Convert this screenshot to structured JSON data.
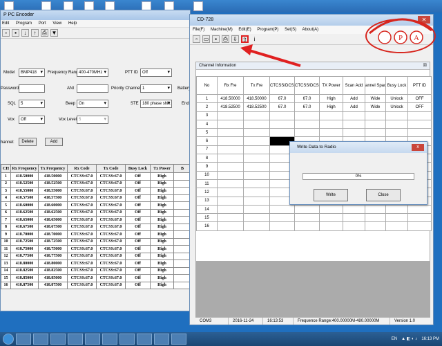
{
  "encoder_window": {
    "title": "P PC Encoder",
    "menu": [
      "Edit",
      "Program",
      "Port",
      "View",
      "Help"
    ],
    "setting_label": "etting",
    "fields": {
      "model_label": "Model",
      "model_value": "BMP418",
      "freq_range_label": "Frequency Range",
      "freq_range_value": "400-470MHz",
      "ptt_id_label": "PTT ID",
      "ptt_id_value": "Off",
      "password_label": "Password",
      "ani_label": "ANI",
      "priority_label": "Priority Channel",
      "priority_value": "1",
      "battery_label": "Battery",
      "sql_label": "SQL",
      "sql_value": "5",
      "beep_label": "Beep",
      "beep_value": "On",
      "ste_label": "STE",
      "ste_value": "180 phase shift",
      "end_label": "End",
      "vox_label": "Vox",
      "vox_value": "Off",
      "vox_level_label": "Vox Level",
      "vox_level_value": "5",
      "channel_label": "hannel:",
      "delete_label": "Delete",
      "add_label": "Add"
    },
    "table": {
      "headers": [
        "CH",
        "Rx Frequency",
        "Tx Frequency",
        "Rx Code",
        "Tx Code",
        "Busy Lock",
        "Tx Power",
        "B"
      ],
      "rows": [
        [
          "1",
          "418.50000",
          "418.50000",
          "CTCSS:67.0",
          "CTCSS:67.0",
          "Off",
          "High",
          ""
        ],
        [
          "2",
          "418.52500",
          "418.52500",
          "CTCSS:67.0",
          "CTCSS:67.0",
          "Off",
          "High",
          ""
        ],
        [
          "3",
          "418.55000",
          "418.55000",
          "CTCSS:67.0",
          "CTCSS:67.0",
          "Off",
          "High",
          ""
        ],
        [
          "4",
          "418.57500",
          "418.57500",
          "CTCSS:67.0",
          "CTCSS:67.0",
          "Off",
          "High",
          ""
        ],
        [
          "5",
          "418.60000",
          "418.60000",
          "CTCSS:67.0",
          "CTCSS:67.0",
          "Off",
          "High",
          ""
        ],
        [
          "6",
          "418.62500",
          "418.62500",
          "CTCSS:67.0",
          "CTCSS:67.0",
          "Off",
          "High",
          ""
        ],
        [
          "7",
          "418.65000",
          "418.65000",
          "CTCSS:67.0",
          "CTCSS:67.0",
          "Off",
          "High",
          ""
        ],
        [
          "8",
          "418.67500",
          "418.67500",
          "CTCSS:67.0",
          "CTCSS:67.0",
          "Off",
          "High",
          ""
        ],
        [
          "9",
          "418.70000",
          "418.70000",
          "CTCSS:67.0",
          "CTCSS:67.0",
          "Off",
          "High",
          ""
        ],
        [
          "10",
          "418.72500",
          "418.72500",
          "CTCSS:67.0",
          "CTCSS:67.0",
          "Off",
          "High",
          ""
        ],
        [
          "11",
          "418.75000",
          "418.75000",
          "CTCSS:67.0",
          "CTCSS:67.0",
          "Off",
          "High",
          ""
        ],
        [
          "12",
          "418.77500",
          "418.77500",
          "CTCSS:67.0",
          "CTCSS:67.0",
          "Off",
          "High",
          ""
        ],
        [
          "13",
          "418.80000",
          "418.80000",
          "CTCSS:67.0",
          "CTCSS:67.0",
          "Off",
          "High",
          ""
        ],
        [
          "14",
          "418.82500",
          "418.82500",
          "CTCSS:67.0",
          "CTCSS:67.0",
          "Off",
          "High",
          ""
        ],
        [
          "15",
          "418.85000",
          "418.85000",
          "CTCSS:67.0",
          "CTCSS:67.0",
          "Off",
          "High",
          ""
        ],
        [
          "16",
          "418.87500",
          "418.87500",
          "CTCSS:67.0",
          "CTCSS:67.0",
          "Off",
          "High",
          ""
        ]
      ]
    }
  },
  "cd_window": {
    "title": "CD-728",
    "menu": [
      "File(F)",
      "Machine(M)",
      "Edit(E)",
      "Program(P)",
      "Set(S)",
      "About(A)"
    ],
    "panel_title": "Channel Information",
    "panel_close": "☒",
    "table": {
      "headers": [
        "No",
        "Rx Fre",
        "Tx Fre",
        "CTCSS/DCS Dec",
        "CTCSS/DCS Enc",
        "TX Power",
        "Scan Add",
        "annel Spac",
        "Busy Lock",
        "PTT ID"
      ],
      "rows": [
        [
          "1",
          "418.50000",
          "418.50000",
          "67.0",
          "67.0",
          "High",
          "Add",
          "Wide",
          "Unlock",
          "OFF"
        ],
        [
          "2",
          "418.52500",
          "418.52500",
          "67.0",
          "67.0",
          "High",
          "Add",
          "Wide",
          "Unlock",
          "OFF"
        ],
        [
          "3",
          "",
          "",
          "",
          "",
          "",
          "",
          "",
          "",
          ""
        ],
        [
          "4",
          "",
          "",
          "",
          "",
          "",
          "",
          "",
          "",
          ""
        ],
        [
          "5",
          "",
          "",
          "",
          "",
          "",
          "",
          "",
          "",
          ""
        ],
        [
          "6",
          "",
          "",
          "",
          "",
          "",
          "",
          "",
          "",
          ""
        ],
        [
          "7",
          "",
          "",
          "",
          "",
          "",
          "",
          "",
          "",
          ""
        ],
        [
          "8",
          "",
          "",
          "",
          "",
          "",
          "",
          "",
          "",
          ""
        ],
        [
          "9",
          "",
          "",
          "",
          "",
          "",
          "",
          "",
          "",
          ""
        ],
        [
          "10",
          "",
          "",
          "",
          "",
          "",
          "",
          "",
          "",
          ""
        ],
        [
          "11",
          "",
          "",
          "",
          "",
          "",
          "",
          "",
          "",
          ""
        ],
        [
          "12",
          "",
          "",
          "",
          "",
          "",
          "",
          "",
          "",
          ""
        ],
        [
          "13",
          "",
          "",
          "",
          "",
          "",
          "",
          "",
          "",
          ""
        ],
        [
          "14",
          "",
          "",
          "",
          "",
          "",
          "",
          "",
          "",
          ""
        ],
        [
          "15",
          "",
          "",
          "",
          "",
          "",
          "",
          "",
          "",
          ""
        ],
        [
          "16",
          "",
          "",
          "",
          "",
          "",
          "",
          "",
          "",
          ""
        ]
      ]
    },
    "status": [
      "COM3",
      "2016-11-24",
      "16:13:53",
      "Frequence Range:400.00000M-480.00000M",
      "Version 1.0"
    ]
  },
  "dialog": {
    "title": "Write Data to Radio",
    "close": "x",
    "progress_text": "0%",
    "progress": 0,
    "write_label": "Write",
    "close_label": "Close"
  },
  "taskbar": {
    "lang": "EN",
    "clock": "16:13 PM"
  },
  "logo": {
    "letters": [
      "P",
      "A"
    ],
    "color": "#d7261e"
  },
  "colors": {
    "accent_red": "#e02020",
    "progress_green": "#4caf50"
  }
}
